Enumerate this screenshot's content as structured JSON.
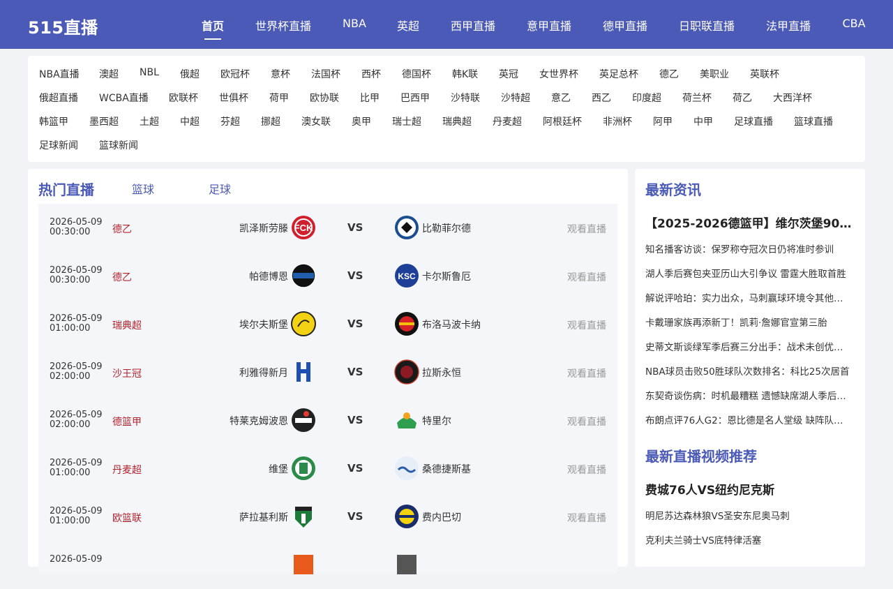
{
  "site": {
    "logo": "515直播"
  },
  "nav": [
    "首页",
    "世界杯直播",
    "NBA",
    "英超",
    "西甲直播",
    "意甲直播",
    "德甲直播",
    "日职联直播",
    "法甲直播",
    "CBA"
  ],
  "categories": [
    [
      "NBA直播",
      "澳超",
      "NBL",
      "俄超",
      "欧冠杯",
      "意杯",
      "法国杯",
      "西杯",
      "德国杯",
      "韩K联",
      "英冠",
      "女世界杯",
      "英足总杯",
      "德乙",
      "美职业",
      "英联杯"
    ],
    [
      "俄超直播",
      "WCBA直播",
      "欧联杯",
      "世俱杯",
      "荷甲",
      "欧协联",
      "比甲",
      "巴西甲",
      "沙特联",
      "沙特超",
      "意乙",
      "西乙",
      "印度超",
      "荷兰杯",
      "荷乙",
      "大西洋杯"
    ],
    [
      "韩篮甲",
      "墨西超",
      "土超",
      "中超",
      "芬超",
      "挪超",
      "澳女联",
      "奥甲",
      "瑞士超",
      "瑞典超",
      "丹麦超",
      "阿根廷杯",
      "非洲杯",
      "阿甲",
      "中甲",
      "足球直播",
      "篮球直播"
    ],
    [
      "足球新闻",
      "篮球新闻"
    ]
  ],
  "hot": {
    "title": "热门直播",
    "tabs": [
      "篮球",
      "足球"
    ],
    "vs_label": "VS",
    "watch_label": "观看直播",
    "matches": [
      {
        "date": "2026-05-09",
        "time": "00:30:00",
        "league": "德乙",
        "home": "凯泽斯劳滕",
        "away": "比勒菲尔德",
        "home_logo": "kaiserslautern-logo",
        "away_logo": "bielefeld-logo"
      },
      {
        "date": "2026-05-09",
        "time": "00:30:00",
        "league": "德乙",
        "home": "帕德博恩",
        "away": "卡尔斯鲁厄",
        "home_logo": "paderborn-logo",
        "away_logo": "karlsruhe-logo"
      },
      {
        "date": "2026-05-09",
        "time": "01:00:00",
        "league": "瑞典超",
        "home": "埃尔夫斯堡",
        "away": "布洛马波卡纳",
        "home_logo": "elfsborg-logo",
        "away_logo": "brommapojkarna-logo"
      },
      {
        "date": "2026-05-09",
        "time": "02:00:00",
        "league": "沙王冠",
        "home": "利雅得新月",
        "away": "拉斯永恒",
        "home_logo": "alhilal-logo",
        "away_logo": "alkholood-logo"
      },
      {
        "date": "2026-05-09",
        "time": "02:00:00",
        "league": "德篮甲",
        "home": "特莱克姆波恩",
        "away": "特里尔",
        "home_logo": "bonn-baskets-logo",
        "away_logo": "trier-logo"
      },
      {
        "date": "2026-05-09",
        "time": "01:00:00",
        "league": "丹麦超",
        "home": "维堡",
        "away": "桑德捷斯基",
        "home_logo": "viborg-logo",
        "away_logo": "sonderjyske-logo"
      },
      {
        "date": "2026-05-09",
        "time": "01:00:00",
        "league": "欧篮联",
        "home": "萨拉基利斯",
        "away": "费内巴切",
        "home_logo": "zalgiris-logo",
        "away_logo": "fenerbahce-logo"
      },
      {
        "date": "2026-05-09",
        "time": "",
        "league": "",
        "home": "",
        "away": "",
        "home_logo": "partial-logo",
        "away_logo": "partial-logo"
      }
    ]
  },
  "news": {
    "title": "最新资讯",
    "headline": "【2025-2026德篮甲】维尔茨堡90-…",
    "items": [
      "知名播客访谈：保罗称夺冠次日仍将准时参训",
      "湖人季后赛包夹亚历山大引争议 雷霆大胜取首胜",
      "解说评哈珀：实力出众，马刺赢球环境令其他…",
      "卡戴珊家族再添新丁！凯莉·詹娜官宣第三胎",
      "史蒂文斯谈绿军季后赛三分出手：战术未创优…",
      "NBA球员击败50胜球队次数排名：科比25次居首",
      "东契奇谈伤病：时机最糟糕 遗憾缺席湖人季后…",
      "布朗点评76人G2：恩比德是名人堂级 缺阵队…"
    ]
  },
  "videos": {
    "title": "最新直播视频推荐",
    "headline": "费城76人VS纽约尼克斯",
    "items": [
      "明尼苏达森林狼VS圣安东尼奥马刺",
      "克利夫兰骑士VS底特律活塞"
    ]
  },
  "colors": {
    "brand": "#4b5ab6",
    "league": "#b4232c",
    "muted": "#999999"
  }
}
